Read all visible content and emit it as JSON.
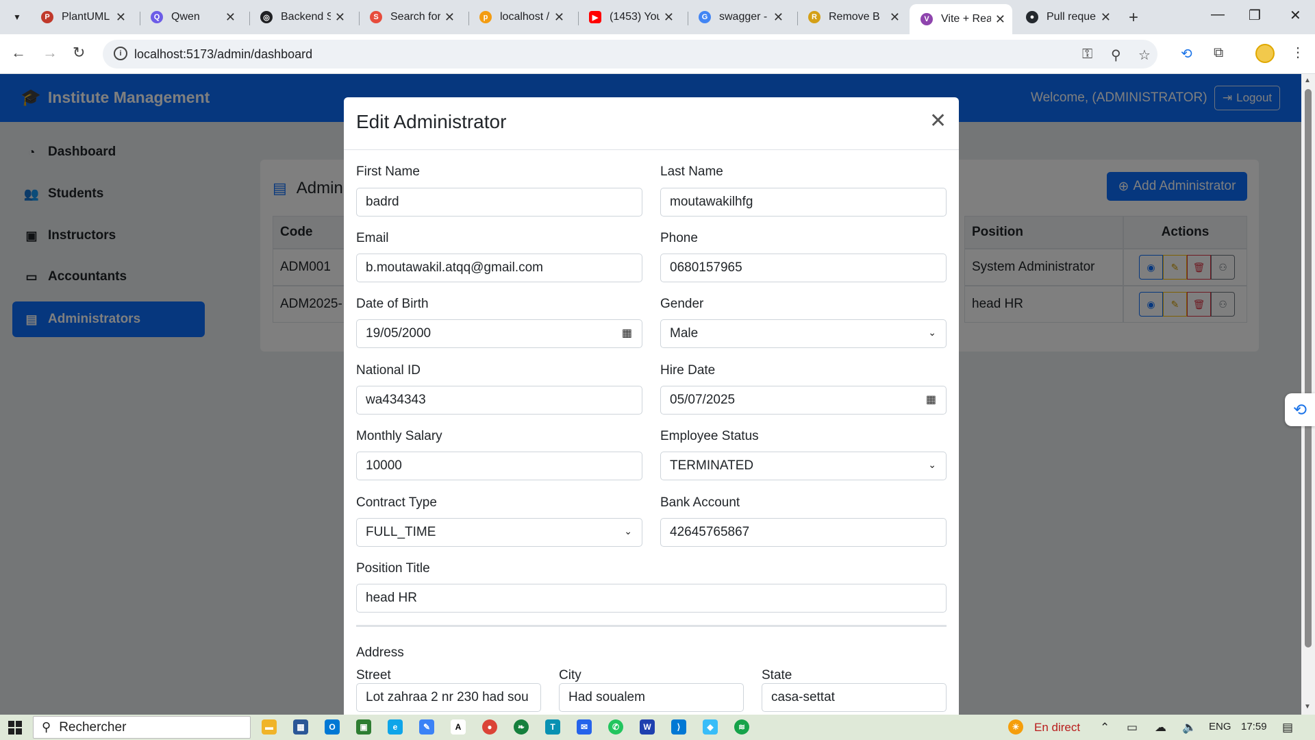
{
  "browser": {
    "tabs": [
      {
        "title": "PlantUML",
        "icon": "plantuml-icon",
        "color": "#c0392b"
      },
      {
        "title": "Qwen",
        "icon": "qwen-icon",
        "color": "#6c5ce7"
      },
      {
        "title": "Backend S",
        "icon": "openai-icon",
        "color": "#202124"
      },
      {
        "title": "Search for",
        "icon": "search-site-icon",
        "color": "#e74c3c"
      },
      {
        "title": "localhost /",
        "icon": "phpmyadmin-icon",
        "color": "#f39c12"
      },
      {
        "title": "(1453) You",
        "icon": "youtube-icon",
        "color": "#ff0000"
      },
      {
        "title": "swagger -",
        "icon": "google-icon",
        "color": "#4285f4"
      },
      {
        "title": "Remove B",
        "icon": "removebg-icon",
        "color": "#d4a017"
      },
      {
        "title": "Vite + Rea",
        "icon": "vite-icon",
        "color": "#8e44ad"
      },
      {
        "title": "Pull reque",
        "icon": "github-icon",
        "color": "#24292e"
      }
    ],
    "active_tab_index": 8,
    "url": "localhost:5173/admin/dashboard"
  },
  "app": {
    "brand": "Institute Management",
    "welcome": "Welcome, (ADMINISTRATOR)",
    "logout": "Logout",
    "accent_color": "#0d6efd"
  },
  "sidebar": {
    "items": [
      {
        "label": "Dashboard",
        "icon": "gauge-icon"
      },
      {
        "label": "Students",
        "icon": "users-icon"
      },
      {
        "label": "Instructors",
        "icon": "id-badge-icon"
      },
      {
        "label": "Accountants",
        "icon": "cash-icon"
      },
      {
        "label": "Administrators",
        "icon": "id-card-icon",
        "active": true
      }
    ]
  },
  "main": {
    "title": "Admin",
    "add_button": "Add Administrator",
    "table": {
      "headers": {
        "code": "Code",
        "position": "Position",
        "actions": "Actions"
      },
      "rows": [
        {
          "code": "ADM001",
          "position": "System Administrator"
        },
        {
          "code": "ADM2025-",
          "position": "head HR"
        }
      ]
    }
  },
  "modal": {
    "title": "Edit Administrator",
    "fields": {
      "first_name": {
        "label": "First Name",
        "value": "badrd"
      },
      "last_name": {
        "label": "Last Name",
        "value": "moutawakilhfg"
      },
      "email": {
        "label": "Email",
        "value": "b.moutawakil.atqq@gmail.com"
      },
      "phone": {
        "label": "Phone",
        "value": "0680157965"
      },
      "dob": {
        "label": "Date of Birth",
        "value": "19/05/2000"
      },
      "gender": {
        "label": "Gender",
        "value": "Male"
      },
      "national_id": {
        "label": "National ID",
        "value": "wa434343"
      },
      "hire_date": {
        "label": "Hire Date",
        "value": "05/07/2025"
      },
      "salary": {
        "label": "Monthly Salary",
        "value": "10000"
      },
      "status": {
        "label": "Employee Status",
        "value": "TERMINATED"
      },
      "contract": {
        "label": "Contract Type",
        "value": "FULL_TIME"
      },
      "bank": {
        "label": "Bank Account",
        "value": "42645765867"
      },
      "position": {
        "label": "Position Title",
        "value": "head HR"
      }
    },
    "address": {
      "section": "Address",
      "street": {
        "label": "Street",
        "value": "Lot zahraa 2 nr 230 had sou"
      },
      "city": {
        "label": "City",
        "value": "Had soualem"
      },
      "state": {
        "label": "State",
        "value": "casa-settat"
      }
    }
  },
  "taskbar": {
    "search": "Rechercher",
    "weather": "En direct",
    "lang": "ENG",
    "time": "17:59"
  }
}
